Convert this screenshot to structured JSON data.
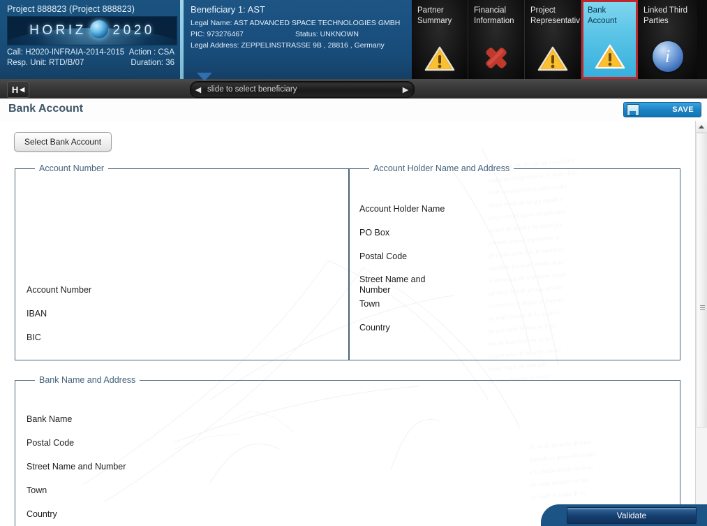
{
  "header": {
    "project": {
      "title": "Project 888823 (Project 888823)",
      "banner_text": "HORIZ N 2020",
      "call_label": "Call: H2020-INFRAIA-2014-2015",
      "action_label": "Action : CSA",
      "resp_unit_label": "Resp. Unit: RTD/B/07",
      "duration_label": "Duration: 36"
    },
    "beneficiary": {
      "title": "Beneficiary 1: AST",
      "legal_name": "Legal Name: AST ADVANCED SPACE TECHNOLOGIES GMBH",
      "pic": "PIC: 973276467",
      "status": "Status: UNKNOWN",
      "legal_address": "Legal Address: ZEPPELINSTRASSE 9B , 28816 , Germany"
    },
    "tabs": [
      {
        "line1": "Partner",
        "line2": "Summary",
        "icon": "warning-triangle-icon",
        "selected": false
      },
      {
        "line1": "Financial",
        "line2": "Information",
        "icon": "error-cross-icon",
        "selected": false
      },
      {
        "line1": "Project",
        "line2": "Representativ",
        "icon": "warning-triangle-icon",
        "selected": false
      },
      {
        "line1": "Bank",
        "line2": "Account",
        "icon": "warning-triangle-icon",
        "selected": true
      },
      {
        "line1": "Linked Third",
        "line2": "Parties",
        "icon": "info-circle-icon",
        "selected": false
      }
    ]
  },
  "slider": {
    "home_button": "H",
    "label": "slide to select beneficiary",
    "arrow_left": "◀",
    "arrow_right": "▶"
  },
  "page": {
    "title": "Bank Account",
    "save_label": "SAVE",
    "select_bank_account_label": "Select Bank Account",
    "validate_label": "Validate"
  },
  "sections": {
    "account_number": {
      "legend": "Account Number",
      "fields": [
        "Account Number",
        "IBAN",
        "BIC"
      ]
    },
    "account_holder": {
      "legend": "Account Holder Name and Address",
      "fields": [
        "Account Holder Name",
        "PO Box",
        "Postal Code",
        "Street Name and Number",
        "Town",
        "Country"
      ]
    },
    "bank_name": {
      "legend": "Bank Name and Address",
      "fields": [
        "Bank Name",
        "Postal Code",
        "Street Name and Number",
        "Town",
        "Country"
      ]
    }
  },
  "colors": {
    "header_blue": "#1a5080",
    "selected_tab_cyan": "#59c3e6",
    "selected_tab_border_red": "#c0272d",
    "save_blue": "#1c84c6",
    "validate_blue": "#143d6d",
    "legend_text": "#44637d",
    "title_text": "#3d5566"
  }
}
